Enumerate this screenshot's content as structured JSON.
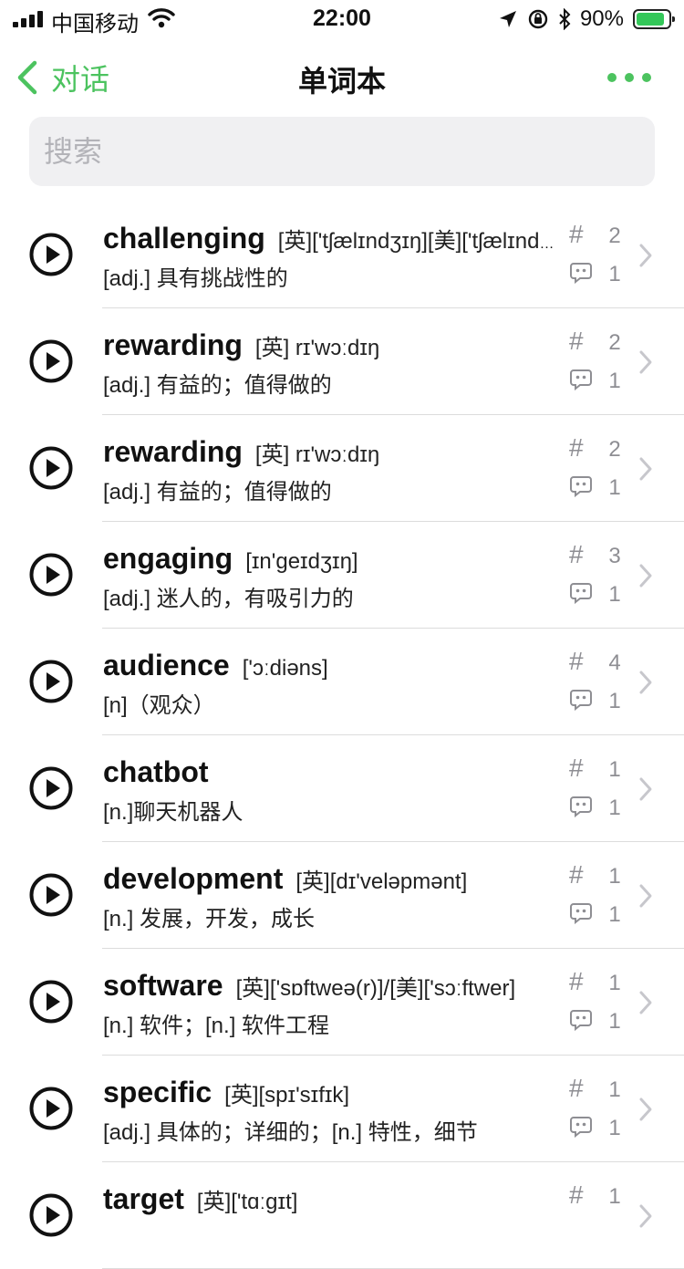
{
  "status_bar": {
    "carrier": "中国移动",
    "time": "22:00",
    "battery": "90%"
  },
  "nav": {
    "back_label": "对话",
    "title": "单词本",
    "more_icon": "more-dots-icon"
  },
  "search": {
    "placeholder": "搜索"
  },
  "colors": {
    "accent": "#4cc35f",
    "secondary_text": "#8e8e93"
  },
  "words": [
    {
      "word": "challenging",
      "phonetic": "[英]['tʃælɪndʒɪŋ][美]['tʃælɪndʒɪŋ]",
      "meaning": "[adj.] 具有挑战性的",
      "tag_count": "2",
      "comment_count": "1"
    },
    {
      "word": "rewarding",
      "phonetic": "[英] rɪ'wɔːdɪŋ",
      "meaning": "[adj.] 有益的；值得做的",
      "tag_count": "2",
      "comment_count": "1"
    },
    {
      "word": "rewarding",
      "phonetic": "[英] rɪ'wɔːdɪŋ",
      "meaning": "[adj.] 有益的；值得做的",
      "tag_count": "2",
      "comment_count": "1"
    },
    {
      "word": "engaging",
      "phonetic": "[ɪn'geɪdʒɪŋ]",
      "meaning": "[adj.] 迷人的，有吸引力的",
      "tag_count": "3",
      "comment_count": "1"
    },
    {
      "word": "audience",
      "phonetic": "['ɔːdiəns]",
      "meaning": "[n]（观众）",
      "tag_count": "4",
      "comment_count": "1"
    },
    {
      "word": "chatbot",
      "phonetic": "",
      "meaning": "[n.]聊天机器人",
      "tag_count": "1",
      "comment_count": "1"
    },
    {
      "word": "development",
      "phonetic": "[英][dɪ'veləpmənt]",
      "meaning": "[n.] 发展，开发，成长",
      "tag_count": "1",
      "comment_count": "1"
    },
    {
      "word": "software",
      "phonetic": "[英]['sɒftweə(r)]/[美]['sɔːftwer]",
      "meaning": "[n.] 软件；[n.] 软件工程",
      "tag_count": "1",
      "comment_count": "1"
    },
    {
      "word": "specific",
      "phonetic": "[英][spɪ'sɪfɪk]",
      "meaning": "[adj.] 具体的；详细的；[n.] 特性，细节",
      "tag_count": "1",
      "comment_count": "1"
    },
    {
      "word": "target",
      "phonetic": "[英]['tɑːgɪt]",
      "meaning": "",
      "tag_count": "1",
      "comment_count": ""
    }
  ]
}
